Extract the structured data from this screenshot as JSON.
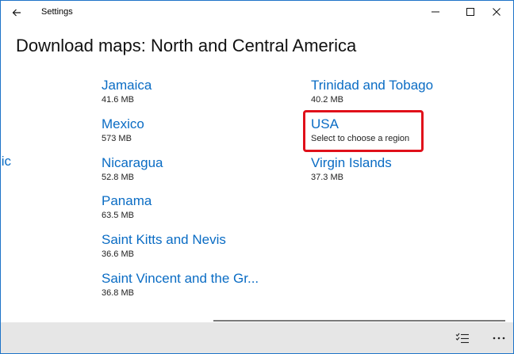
{
  "window": {
    "title": "Settings"
  },
  "page": {
    "title": "Download maps: North and Central America"
  },
  "left_clipped_text": "lic",
  "column1": [
    {
      "name": "Jamaica",
      "size": "41.6 MB"
    },
    {
      "name": "Mexico",
      "size": "573 MB"
    },
    {
      "name": "Nicaragua",
      "size": "52.8 MB"
    },
    {
      "name": "Panama",
      "size": "63.5 MB"
    },
    {
      "name": "Saint Kitts and Nevis",
      "size": "36.6 MB"
    },
    {
      "name": "Saint Vincent and the Gr...",
      "size": "36.8 MB"
    }
  ],
  "column2": [
    {
      "name": "Trinidad and Tobago",
      "size": "40.2 MB"
    },
    {
      "name": "USA",
      "size": "Select to choose a region"
    },
    {
      "name": "Virgin Islands",
      "size": "37.3 MB"
    }
  ],
  "icons": {
    "back": "back-arrow-icon",
    "minimize": "minimize-icon",
    "maximize": "maximize-icon",
    "close": "close-icon",
    "select": "select-list-icon",
    "more": "more-ellipsis-icon"
  },
  "colors": {
    "link": "#0a6cc4",
    "highlight": "#e0101a",
    "command_bar": "#e6e6e6",
    "window_border": "#1e74c8"
  }
}
